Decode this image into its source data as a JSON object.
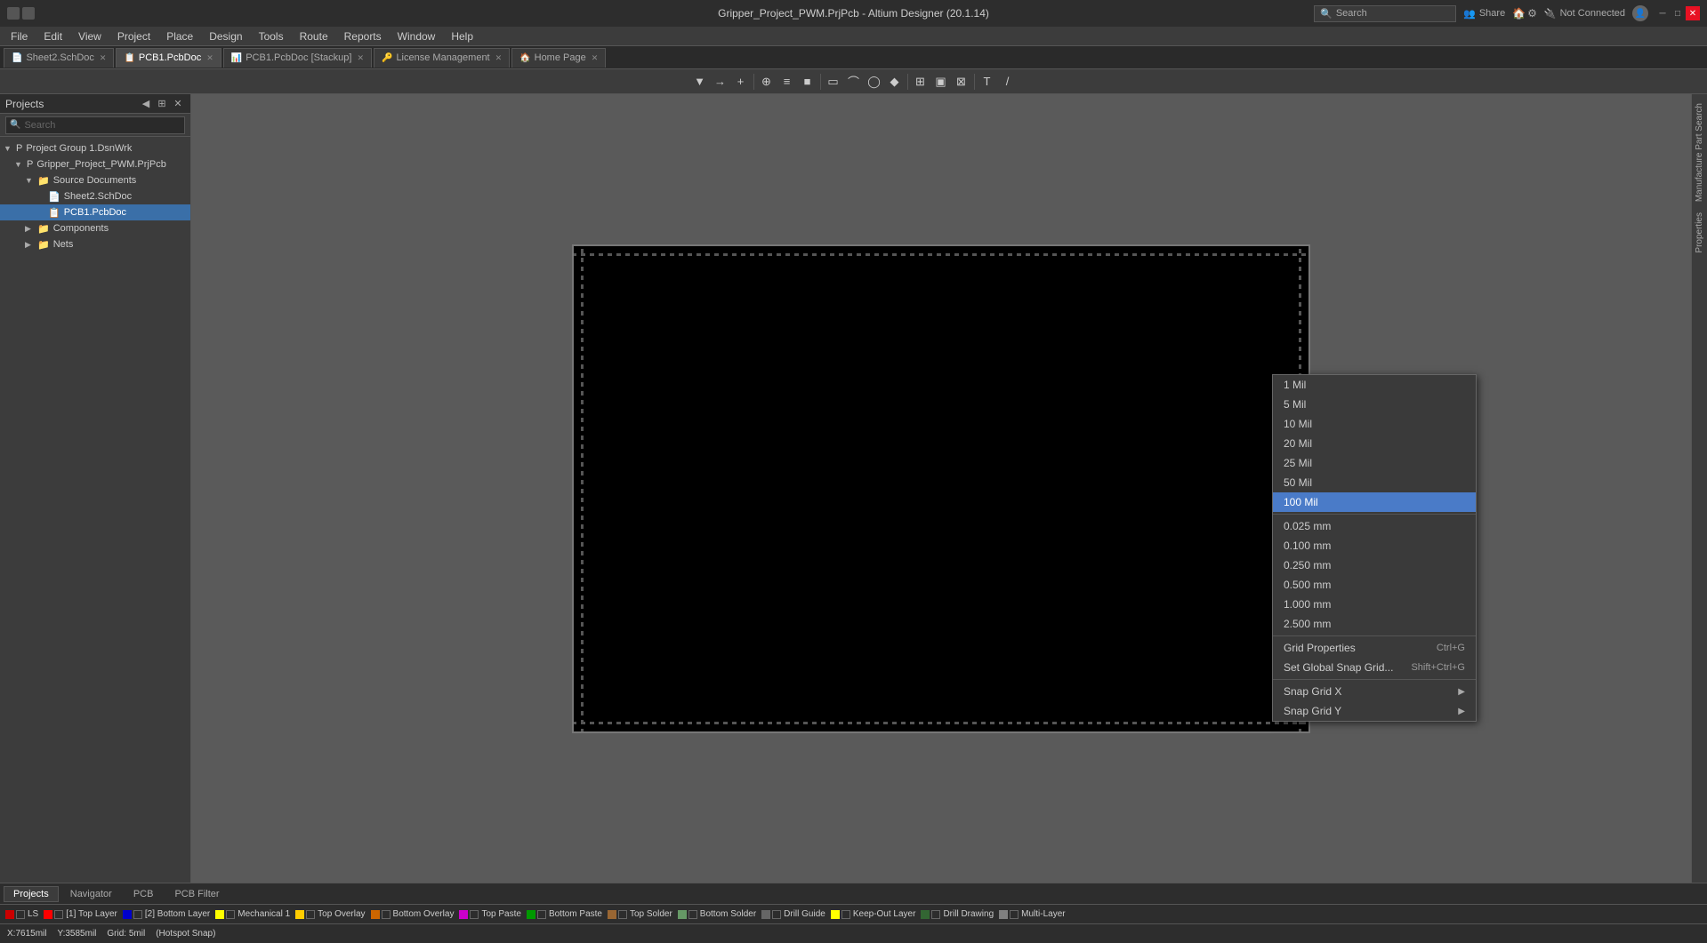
{
  "titleBar": {
    "title": "Gripper_Project_PWM.PrjPcb - Altium Designer (20.1.14)",
    "searchPlaceholder": "Search",
    "notConnected": "Not Connected",
    "windowControls": [
      "—",
      "□",
      "✕"
    ]
  },
  "menuBar": {
    "items": [
      "File",
      "Edit",
      "View",
      "Project",
      "Place",
      "Design",
      "Tools",
      "Route",
      "Reports",
      "Window",
      "Help"
    ]
  },
  "tabs": [
    {
      "label": "Sheet2.SchDoc",
      "icon": "📄",
      "active": false
    },
    {
      "label": "PCB1.PcbDoc",
      "icon": "📋",
      "active": true
    },
    {
      "label": "PCB1.PcbDoc [Stackup]",
      "icon": "📊",
      "active": false
    },
    {
      "label": "License Management",
      "icon": "🔑",
      "active": false
    },
    {
      "label": "Home Page",
      "icon": "🏠",
      "active": false
    }
  ],
  "leftPanel": {
    "title": "Projects",
    "searchPlaceholder": "Search",
    "tree": [
      {
        "label": "Project Group 1.DsnWrk",
        "level": 0,
        "expanded": true,
        "icon": "P",
        "type": "group"
      },
      {
        "label": "Gripper_Project_PWM.PrjPcb",
        "level": 1,
        "expanded": true,
        "icon": "P",
        "type": "project"
      },
      {
        "label": "Source Documents",
        "level": 2,
        "expanded": true,
        "icon": "📁",
        "type": "folder"
      },
      {
        "label": "Sheet2.SchDoc",
        "level": 3,
        "expanded": false,
        "icon": "📄",
        "type": "file"
      },
      {
        "label": "PCB1.PcbDoc",
        "level": 3,
        "expanded": false,
        "icon": "📋",
        "type": "file",
        "selected": true
      },
      {
        "label": "Components",
        "level": 2,
        "expanded": false,
        "icon": "📁",
        "type": "folder"
      },
      {
        "label": "Nets",
        "level": 2,
        "expanded": false,
        "icon": "📁",
        "type": "folder"
      }
    ]
  },
  "rightPanelTabs": [
    "Manufacture Part Search",
    "Properties"
  ],
  "contextMenu": {
    "items": [
      {
        "label": "1 Mil",
        "shortcut": "",
        "selected": false,
        "hasArrow": false
      },
      {
        "label": "5 Mil",
        "shortcut": "",
        "selected": false,
        "hasArrow": false
      },
      {
        "label": "10 Mil",
        "shortcut": "",
        "selected": false,
        "hasArrow": false
      },
      {
        "label": "20 Mil",
        "shortcut": "",
        "selected": false,
        "hasArrow": false
      },
      {
        "label": "25 Mil",
        "shortcut": "",
        "selected": false,
        "hasArrow": false
      },
      {
        "label": "50 Mil",
        "shortcut": "",
        "selected": false,
        "hasArrow": false
      },
      {
        "label": "100 Mil",
        "shortcut": "",
        "selected": true,
        "hasArrow": false
      },
      {
        "separator": true
      },
      {
        "label": "0.025 mm",
        "shortcut": "",
        "selected": false,
        "hasArrow": false
      },
      {
        "label": "0.100 mm",
        "shortcut": "",
        "selected": false,
        "hasArrow": false
      },
      {
        "label": "0.250 mm",
        "shortcut": "",
        "selected": false,
        "hasArrow": false
      },
      {
        "label": "0.500 mm",
        "shortcut": "",
        "selected": false,
        "hasArrow": false
      },
      {
        "label": "1.000 mm",
        "shortcut": "",
        "selected": false,
        "hasArrow": false
      },
      {
        "label": "2.500 mm",
        "shortcut": "",
        "selected": false,
        "hasArrow": false
      },
      {
        "separator": true
      },
      {
        "label": "Grid Properties",
        "shortcut": "Ctrl+G",
        "selected": false,
        "hasArrow": false
      },
      {
        "label": "Set Global Snap Grid...",
        "shortcut": "Shift+Ctrl+G",
        "selected": false,
        "hasArrow": false
      },
      {
        "separator": true
      },
      {
        "label": "Snap Grid X",
        "shortcut": "",
        "selected": false,
        "hasArrow": true
      },
      {
        "label": "Snap Grid Y",
        "shortcut": "",
        "selected": false,
        "hasArrow": true
      }
    ]
  },
  "bottomLayers": [
    {
      "color": "#cc0000",
      "label": "LS",
      "checked": true
    },
    {
      "color": "#ff0000",
      "label": "[1] Top Layer",
      "checked": true
    },
    {
      "color": "#0000cc",
      "label": "[2] Bottom Layer",
      "checked": true
    },
    {
      "color": "#ffff00",
      "label": "Mechanical 1",
      "checked": true
    },
    {
      "color": "#ffcc00",
      "label": "Top Overlay",
      "checked": true
    },
    {
      "color": "#cc6600",
      "label": "Bottom Overlay",
      "checked": true
    },
    {
      "color": "#cc00cc",
      "label": "Top Paste",
      "checked": true
    },
    {
      "color": "#009900",
      "label": "Bottom Paste",
      "checked": true
    },
    {
      "color": "#996633",
      "label": "Top Solder",
      "checked": true
    },
    {
      "color": "#669966",
      "label": "Bottom Solder",
      "checked": true
    },
    {
      "color": "#666666",
      "label": "Drill Guide",
      "checked": true
    },
    {
      "color": "#ffff00",
      "label": "Keep-Out Layer",
      "checked": true
    },
    {
      "color": "#336633",
      "label": "Drill Drawing",
      "checked": true
    },
    {
      "color": "#808080",
      "label": "Multi-Layer",
      "checked": true
    }
  ],
  "panelTabs": [
    "Projects",
    "Navigator",
    "PCB",
    "PCB Filter"
  ],
  "coords": {
    "x": "X:7615mil",
    "y": "Y:3585mil",
    "grid": "Grid: 5mil",
    "hotspot": "(Hotspot Snap)"
  },
  "toolbar": {
    "buttons": [
      "▼",
      "→",
      "+",
      "⊕",
      "≡",
      "■",
      "◻",
      "⌒",
      "◯",
      "◆",
      "⊞",
      "◫",
      "⊠",
      "T",
      "/"
    ]
  }
}
